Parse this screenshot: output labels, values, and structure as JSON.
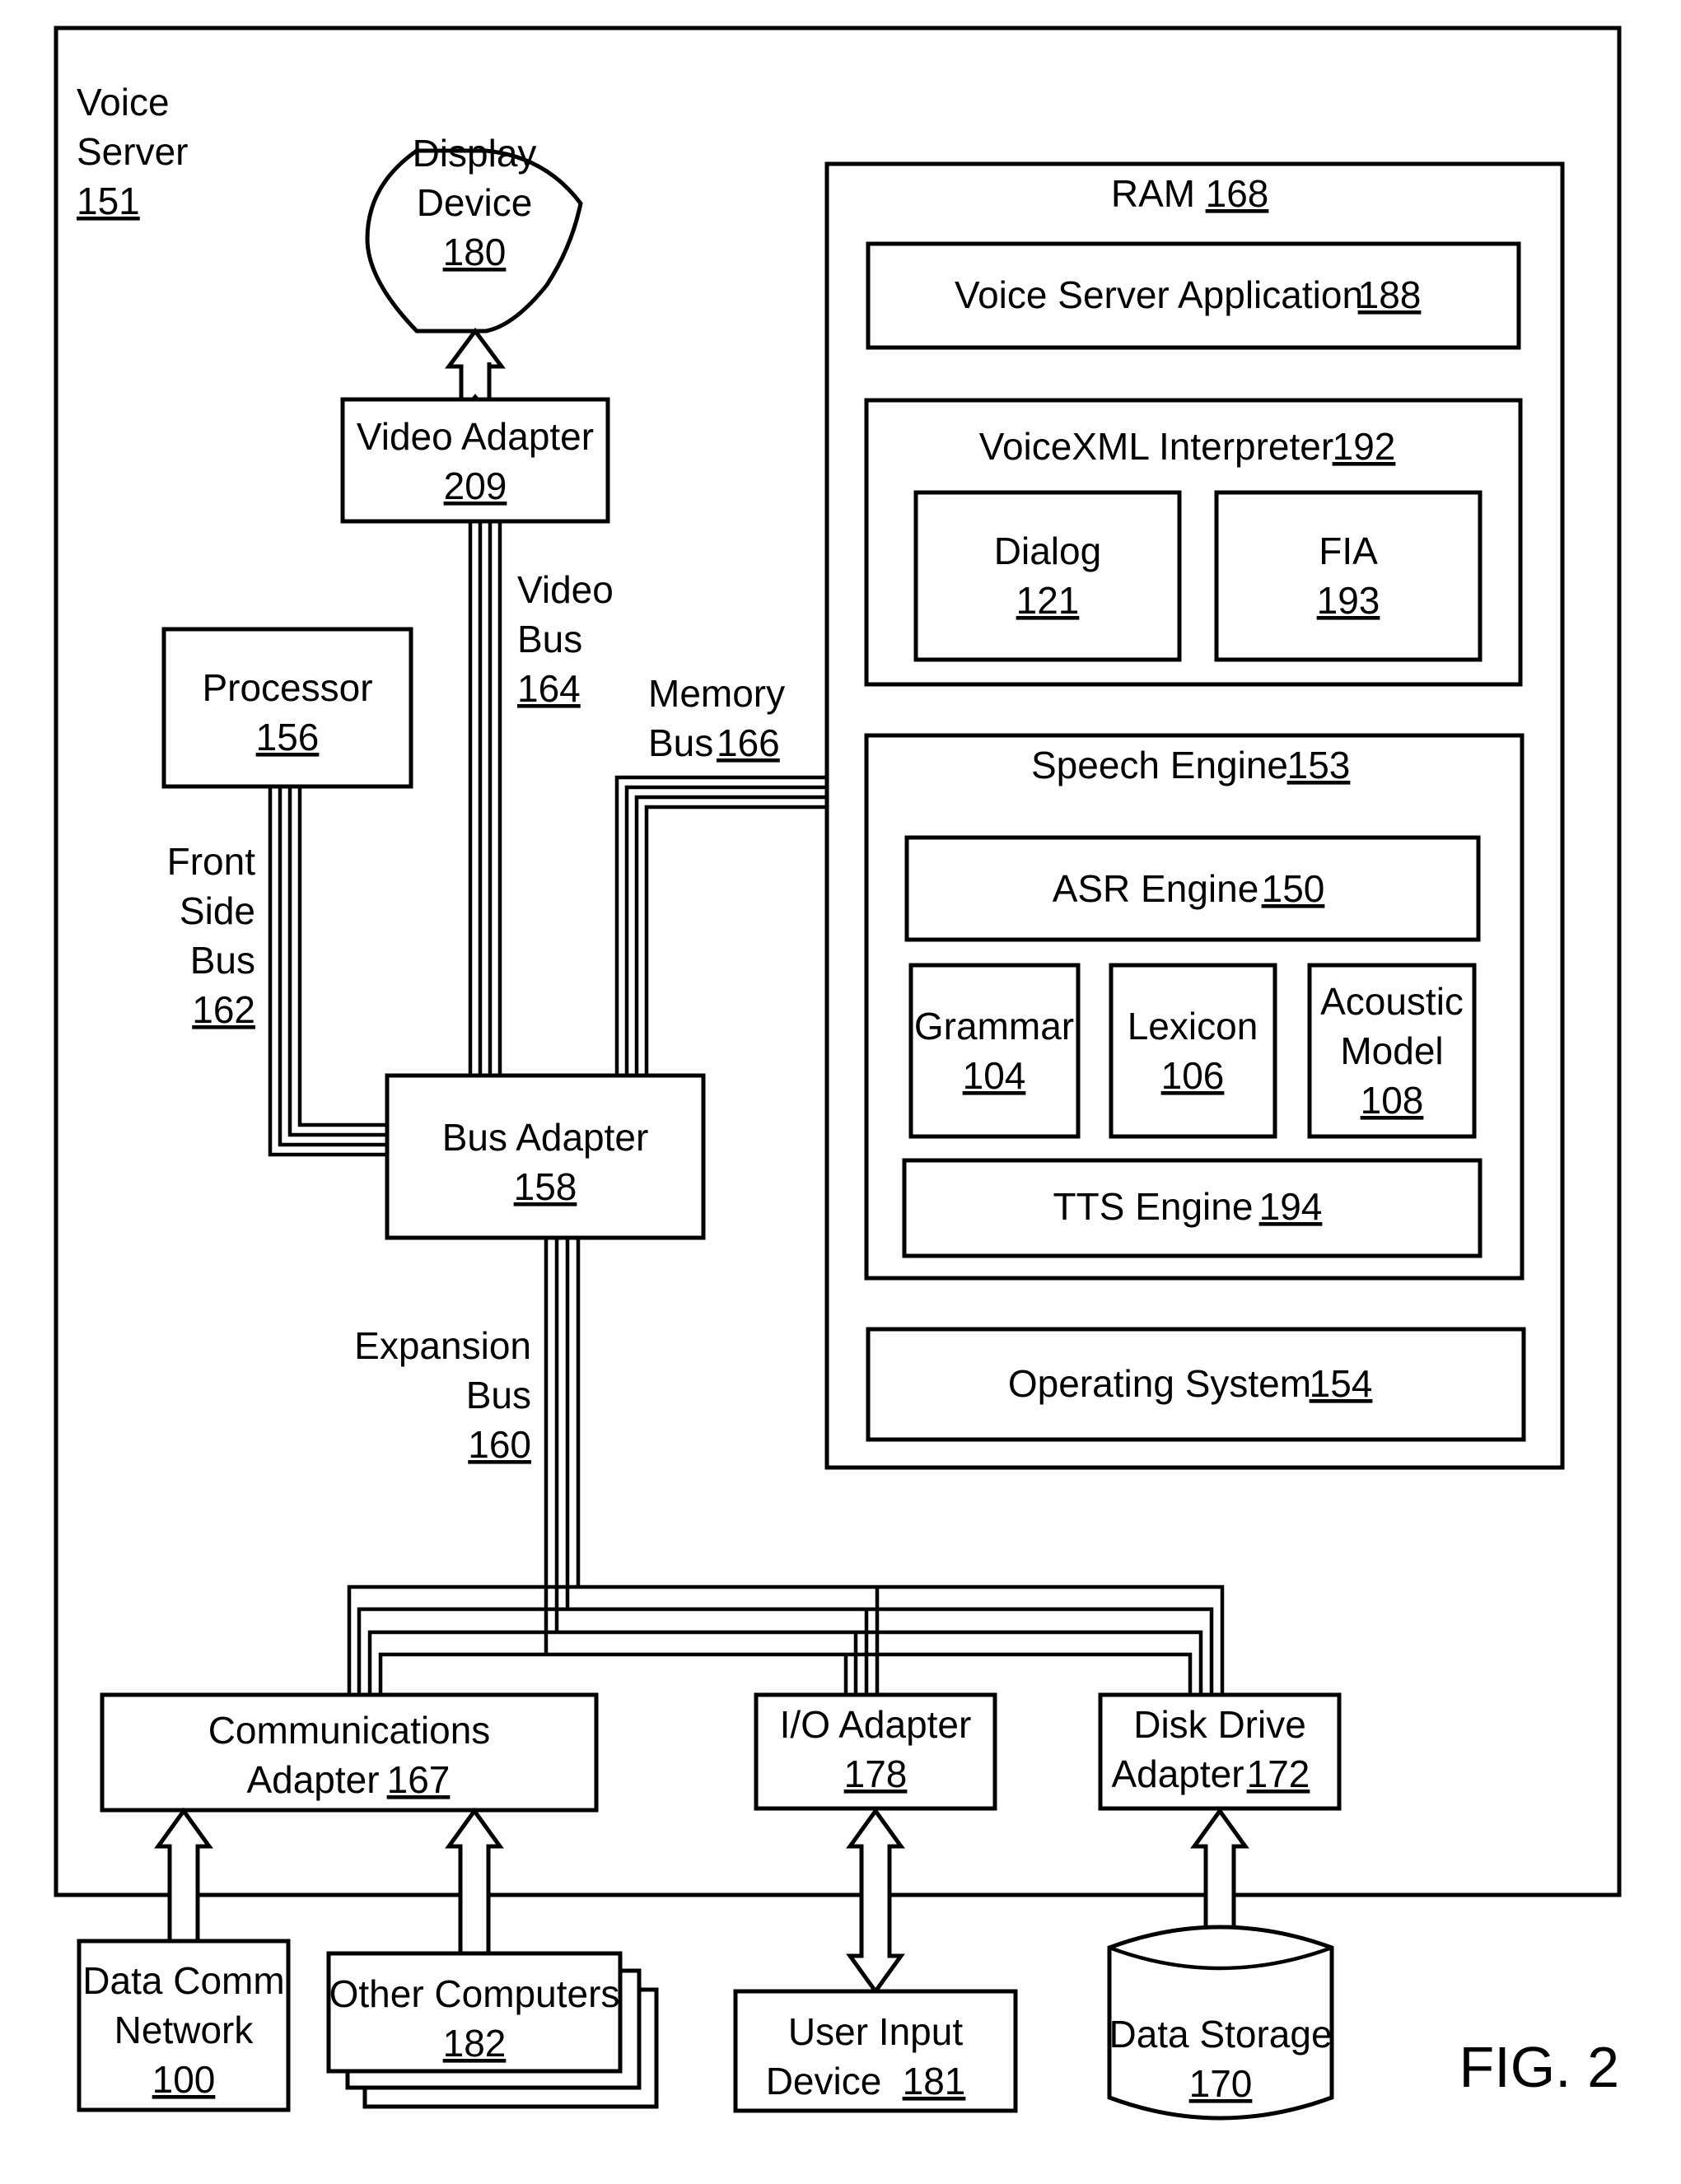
{
  "figure": {
    "label": "FIG. 2",
    "foreground": "#000000",
    "background": "#ffffff"
  },
  "voice_server": {
    "line1": "Voice",
    "line2": "Server",
    "ref": "151"
  },
  "display_device": {
    "line1": "Display",
    "line2": "Device",
    "ref": "180"
  },
  "video_adapter": {
    "name": "Video Adapter",
    "ref": "209"
  },
  "video_bus": {
    "line1": "Video",
    "line2": "Bus",
    "ref": "164"
  },
  "processor": {
    "name": "Processor",
    "ref": "156"
  },
  "front_side_bus": {
    "line1": "Front",
    "line2": "Side",
    "line3": "Bus",
    "ref": "162"
  },
  "memory_bus": {
    "line1": "Memory",
    "line2": "Bus",
    "ref": "166"
  },
  "bus_adapter": {
    "name": "Bus Adapter",
    "ref": "158"
  },
  "expansion_bus": {
    "line1": "Expansion",
    "line2": "Bus",
    "ref": "160"
  },
  "ram": {
    "name": "RAM",
    "ref": "168",
    "voice_server_application": {
      "name": "Voice Server Application",
      "ref": "188"
    },
    "voicexml_interpreter": {
      "name": "VoiceXML Interpreter",
      "ref": "192",
      "dialog": {
        "name": "Dialog",
        "ref": "121"
      },
      "fia": {
        "name": "FIA",
        "ref": "193"
      }
    },
    "speech_engine": {
      "name": "Speech Engine",
      "ref": "153",
      "asr_engine": {
        "name": "ASR Engine",
        "ref": "150"
      },
      "grammar": {
        "name": "Grammar",
        "ref": "104"
      },
      "lexicon": {
        "name": "Lexicon",
        "ref": "106"
      },
      "acoustic_model": {
        "line1": "Acoustic",
        "line2": "Model",
        "ref": "108"
      },
      "tts_engine": {
        "name": "TTS Engine",
        "ref": "194"
      }
    },
    "operating_system": {
      "name": "Operating System",
      "ref": "154"
    }
  },
  "communications_adapter": {
    "line1": "Communications",
    "line2": "Adapter",
    "ref": "167"
  },
  "io_adapter": {
    "name": "I/O Adapter",
    "ref": "178"
  },
  "disk_drive_adapter": {
    "line1": "Disk Drive",
    "line2": "Adapter",
    "ref": "172"
  },
  "data_comm_network": {
    "line1": "Data Comm",
    "line2": "Network",
    "ref": "100"
  },
  "other_computers": {
    "name": "Other Computers",
    "ref": "182"
  },
  "user_input_device": {
    "line1": "User Input",
    "line2": "Device",
    "ref": "181"
  },
  "data_storage": {
    "name": "Data Storage",
    "ref": "170"
  }
}
